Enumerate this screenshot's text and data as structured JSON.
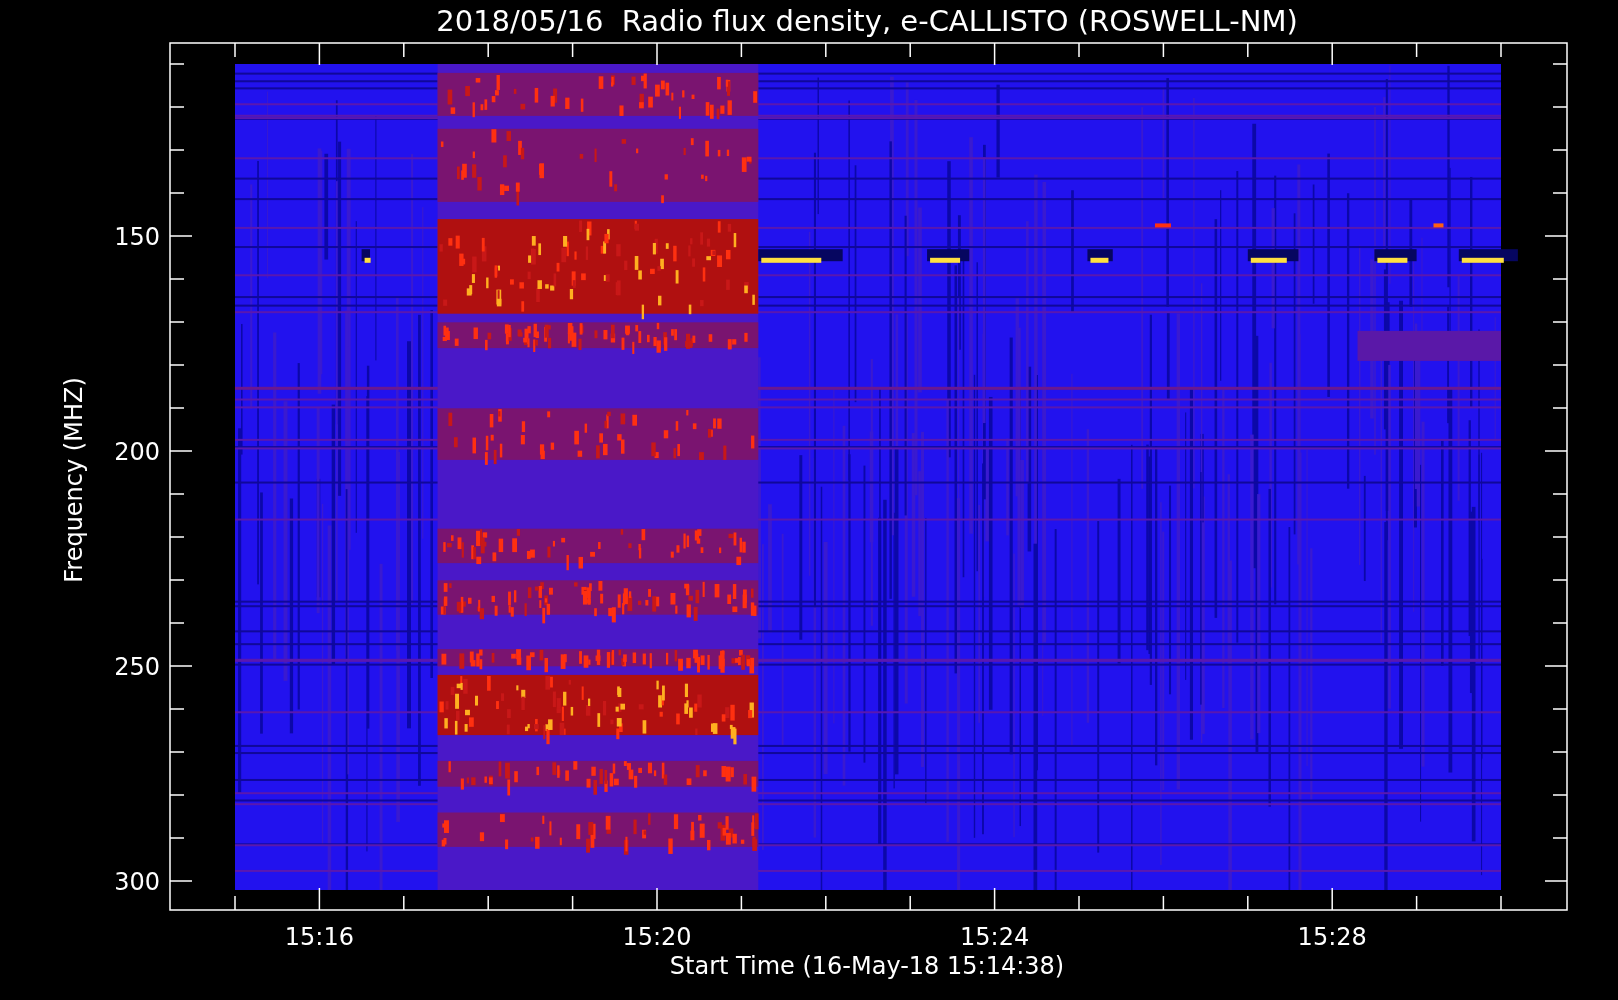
{
  "title": "2018/05/16  Radio flux density, e-CALLISTO (ROSWELL-NM)",
  "y_axis": {
    "label": "Frequency (MHZ)",
    "ticks": [
      "150",
      "200",
      "250",
      "300"
    ]
  },
  "x_axis": {
    "label": "Start Time (16-May-18 15:14:38)",
    "ticks": [
      "15:16",
      "15:20",
      "15:24",
      "15:28"
    ]
  }
}
